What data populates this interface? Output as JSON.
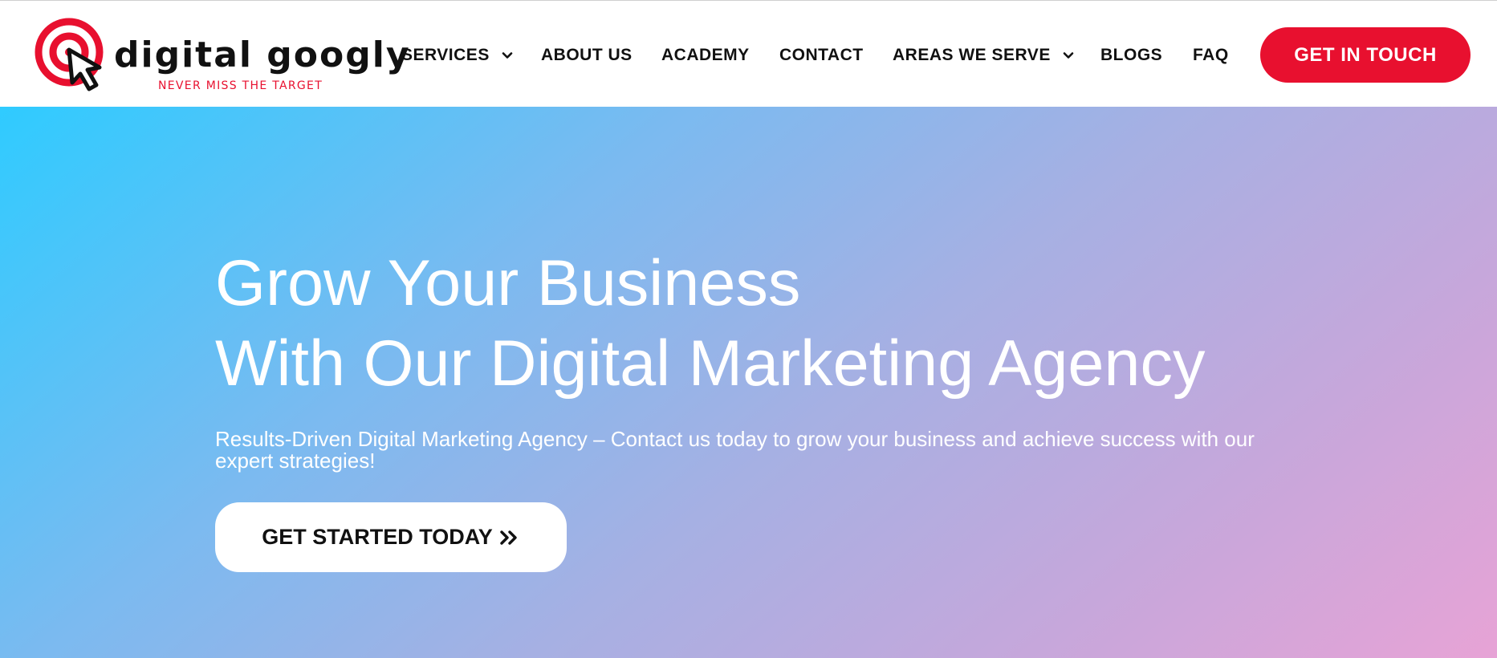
{
  "header": {
    "logo": {
      "wordmark": "digital googly",
      "tagline": "NEVER MISS THE TARGET",
      "icon": "target-cursor-icon"
    },
    "nav": {
      "services": "SERVICES",
      "about": "ABOUT US",
      "academy": "ACADEMY",
      "contact": "CONTACT",
      "areas": "AREAS WE SERVE",
      "blogs": "BLOGS",
      "faq": "FAQ"
    },
    "cta_label": "GET IN TOUCH"
  },
  "hero": {
    "title_line1": "Grow Your Business",
    "title_line2": "With Our Digital Marketing Agency",
    "subtitle": "Results-Driven Digital Marketing Agency – Contact us today to grow your business and achieve success with our expert strategies!",
    "button_label": "GET STARTED TODAY"
  },
  "colors": {
    "brand_red": "#e8102f",
    "text_dark": "#111111",
    "hero_gradient_start": "#2fcbff",
    "hero_gradient_end": "#e7a3d6"
  }
}
